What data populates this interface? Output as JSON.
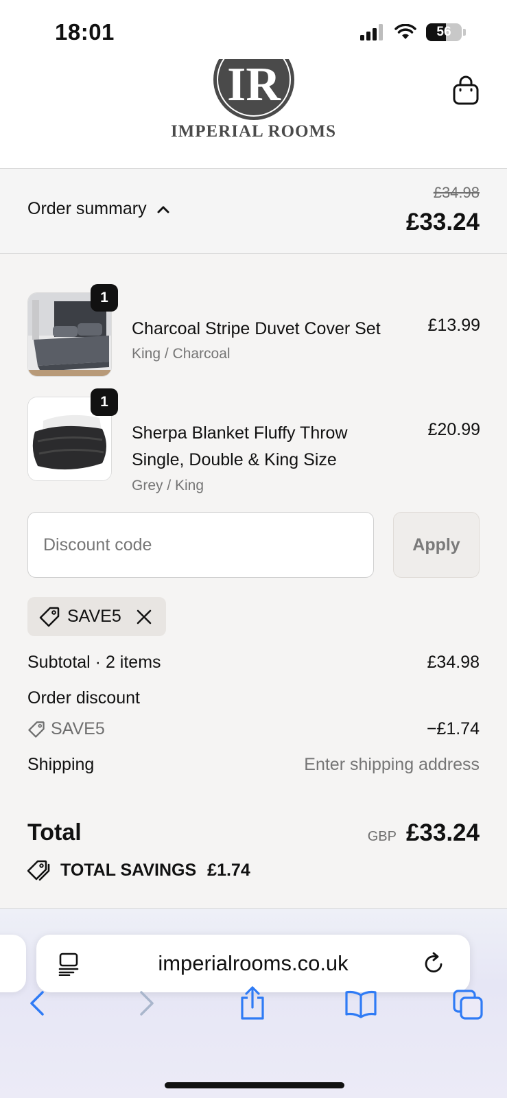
{
  "status_bar": {
    "time": "18:01",
    "battery": "56",
    "battery_level": 0.56
  },
  "header": {
    "logo_monogram": "IR",
    "logo_text": "IMPERIAL ROOMS",
    "cart_icon": "shopping-bag-icon"
  },
  "summary": {
    "toggle_label": "Order summary",
    "original_total": "£34.98",
    "total": "£33.24"
  },
  "items": [
    {
      "title": "Charcoal Stripe Duvet Cover Set",
      "variant": "King / Charcoal",
      "price": "£13.99",
      "quantity": "1"
    },
    {
      "title": "Sherpa Blanket Fluffy Throw Single, Double & King Size",
      "variant": "Grey / King",
      "price": "£20.99",
      "quantity": "1"
    }
  ],
  "discount": {
    "placeholder": "Discount code",
    "apply_label": "Apply",
    "applied_code": "SAVE5"
  },
  "totals": {
    "subtotal_label": "Subtotal · 2 items",
    "subtotal_value": "£34.98",
    "order_discount_label": "Order discount",
    "discount_code": "SAVE5",
    "discount_value": "−£1.74",
    "shipping_label": "Shipping",
    "shipping_value": "Enter shipping address",
    "total_label": "Total",
    "currency": "GBP",
    "total_value": "£33.24",
    "savings_label": "TOTAL SAVINGS",
    "savings_value": "£1.74"
  },
  "browser": {
    "url": "imperialrooms.co.uk"
  },
  "colors": {
    "background": "#f5f4f3",
    "text": "#111111",
    "muted": "#757575",
    "badge": "#111111"
  }
}
